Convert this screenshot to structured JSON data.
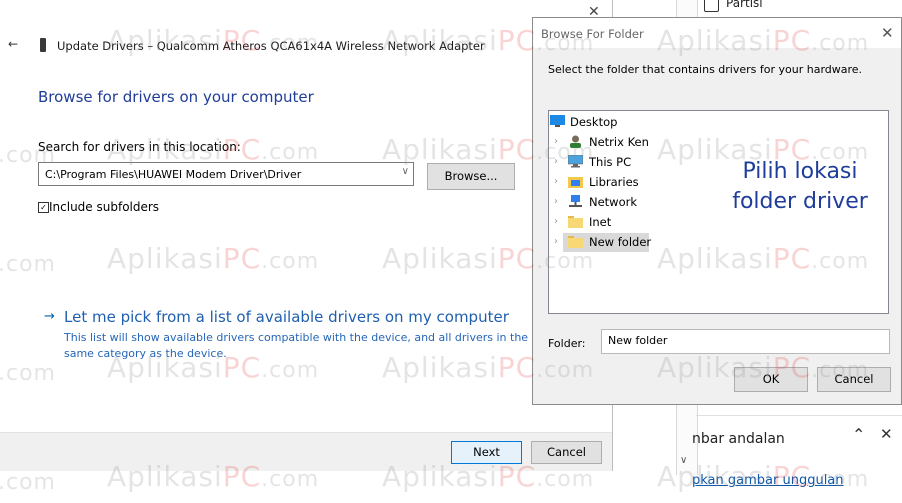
{
  "background": {
    "checkbox_label": "Partisi",
    "section_title": "nbar andalan",
    "link_text": "pkan gambar unggulan"
  },
  "update_window": {
    "title": "Update Drivers – Qualcomm Atheros QCA61x4A Wireless Network Adapter",
    "heading": "Browse for drivers on your computer",
    "search_label": "Search for drivers in this location:",
    "path_value": "C:\\Program Files\\HUAWEI Modem Driver\\Driver",
    "browse_button": "Browse...",
    "include_subfolders": "Include subfolders",
    "pick_link": "Let me pick from a list of available drivers on my computer",
    "pick_description": "This list will show available drivers compatible with the device, and all drivers in the same category as the device.",
    "next_button": "Next",
    "cancel_button": "Cancel"
  },
  "browse_dialog": {
    "title": "Browse For Folder",
    "instruction": "Select the folder that contains drivers for your hardware.",
    "tree": [
      {
        "label": "Desktop",
        "icon": "desktop-icon"
      },
      {
        "label": "Netrix Ken",
        "icon": "user-icon"
      },
      {
        "label": "This PC",
        "icon": "computer-icon"
      },
      {
        "label": "Libraries",
        "icon": "libraries-icon"
      },
      {
        "label": "Network",
        "icon": "network-icon"
      },
      {
        "label": "Inet",
        "icon": "folder-icon"
      },
      {
        "label": "New folder",
        "icon": "folder-icon",
        "selected": true
      }
    ],
    "annotation_line1": "Pilih lokasi",
    "annotation_line2": "folder driver",
    "folder_label": "Folder:",
    "folder_value": "New folder",
    "ok_button": "OK",
    "cancel_button": "Cancel"
  },
  "watermark": {
    "part1": "Aplikasi",
    "part2": "PC",
    "part3": ".com",
    "fragment": ".com"
  }
}
